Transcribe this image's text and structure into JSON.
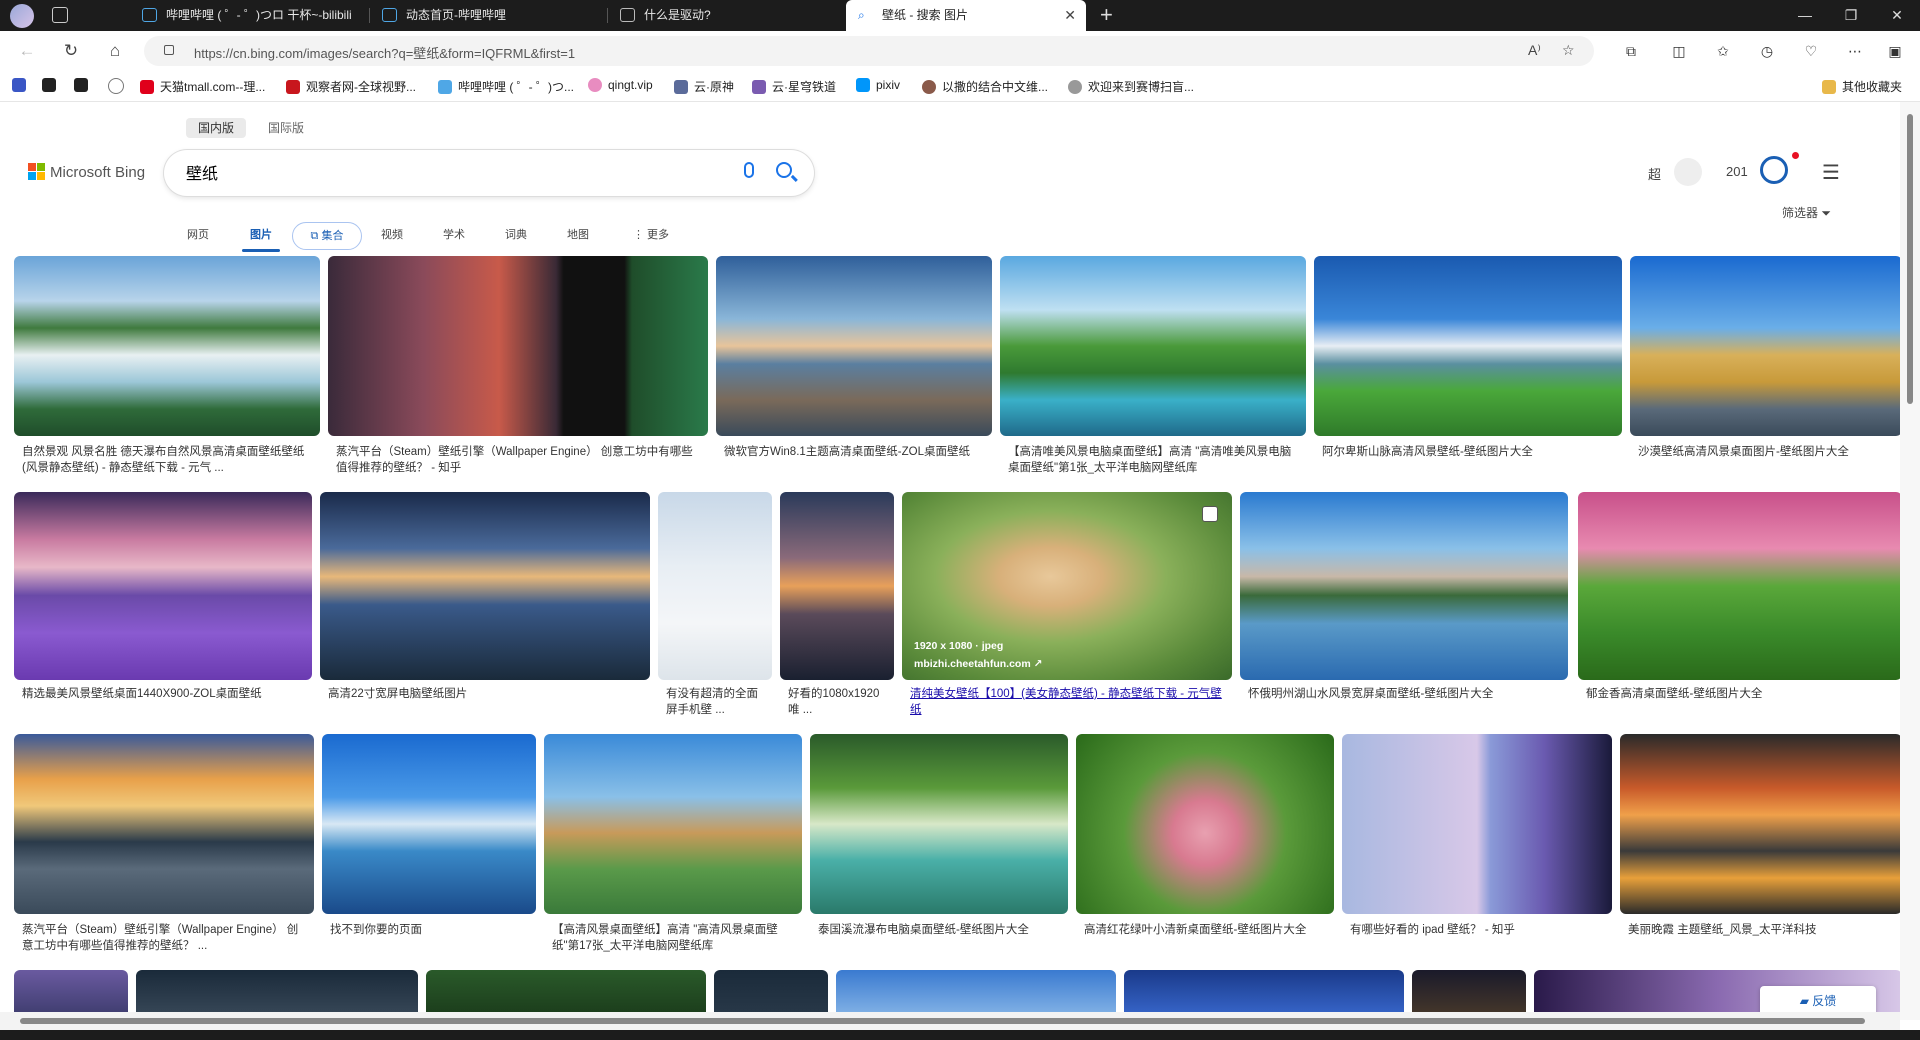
{
  "tabs": [
    {
      "label": "哔哩哔哩 ( ゜- ゜)つロ 干杯~-bilibili"
    },
    {
      "label": "动态首页-哔哩哔哩"
    },
    {
      "label": "什么是驱动?"
    },
    {
      "label": "壁纸 - 搜索 图片"
    }
  ],
  "window": {
    "new_tab": "+",
    "minimize": "—",
    "restore": "❐",
    "close": "✕",
    "tab_close": "✕"
  },
  "address": {
    "url": "https://cn.bing.com/images/search?q=壁纸&form=IQFRML&first=1",
    "read_aloud": "A⁾",
    "favorite": "☆"
  },
  "favorites": [
    {
      "label": "",
      "color": "#3a56c5"
    },
    {
      "label": "",
      "color": "#222222"
    },
    {
      "label": "",
      "color": "#222222"
    },
    {
      "label": "",
      "color": "#888888"
    },
    {
      "label": "天猫tmall.com--理...",
      "color": "#e0001b"
    },
    {
      "label": "观察者网-全球视野...",
      "color": "#c8161d"
    },
    {
      "label": "哔哩哔哩 ( ゜- ゜)つ...",
      "color": "#4fa7e6"
    },
    {
      "label": "qingt.vip",
      "color": "#e88cc0"
    },
    {
      "label": "云·原神",
      "color": "#5b6b9a"
    },
    {
      "label": "云·星穹铁道",
      "color": "#7a5bb0"
    },
    {
      "label": "pixiv",
      "color": "#0096fa"
    },
    {
      "label": "以撒的结合中文维...",
      "color": "#8a5a4a"
    },
    {
      "label": "欢迎来到赛博扫盲...",
      "color": "#999999"
    },
    {
      "label": "其他收藏夹",
      "color": "#e8b84a"
    }
  ],
  "bing": {
    "regions": [
      "国内版",
      "国际版"
    ],
    "logo": "Microsoft Bing",
    "query": "壁纸",
    "user_label": "超",
    "points": "201",
    "verticals": [
      "网页",
      "图片",
      "集合",
      "视频",
      "学术",
      "词典",
      "地图",
      "⋮ 更多"
    ],
    "filter": "筛选器",
    "feedback": "反馈"
  },
  "results": [
    {
      "caption": "自然景观 风景名胜 德天瀑布自然风景高清桌面壁纸壁纸(风景静态壁纸) - 静态壁纸下载 - 元气 ..."
    },
    {
      "caption": "蒸汽平台（Steam）壁纸引擎（Wallpaper Engine） 创意工坊中有哪些值得推荐的壁纸？ - 知乎"
    },
    {
      "caption": "微软官方Win8.1主题高清桌面壁纸-ZOL桌面壁纸"
    },
    {
      "caption": "【高清唯美风景电脑桌面壁纸】高清 \"高清唯美风景电脑桌面壁纸\"第1张_太平洋电脑网壁纸库"
    },
    {
      "caption": "阿尔卑斯山脉高清风景壁纸-壁纸图片大全"
    },
    {
      "caption": "沙漠壁纸高清风景桌面图片-壁纸图片大全"
    },
    {
      "caption": "精选最美风景壁纸桌面1440X900-ZOL桌面壁纸"
    },
    {
      "caption": "高清22寸宽屏电脑壁纸图片"
    },
    {
      "caption": "有没有超清的全面屏手机壁 ..."
    },
    {
      "caption": "好看的1080x1920唯 ..."
    },
    {
      "caption": "清纯美女壁纸【100】(美女静态壁纸) - 静态壁纸下载 - 元气壁纸",
      "meta": "1920 x 1080 · jpeg",
      "source": "mbizhi.cheetahfun.com ↗"
    },
    {
      "caption": "怀俄明州湖山水风景宽屏桌面壁纸-壁纸图片大全"
    },
    {
      "caption": "郁金香高清桌面壁纸-壁纸图片大全"
    },
    {
      "caption": "蒸汽平台（Steam）壁纸引擎（Wallpaper Engine） 创意工坊中有哪些值得推荐的壁纸？ ..."
    },
    {
      "caption": "找不到你要的页面"
    },
    {
      "caption": "【高清风景桌面壁纸】高清 \"高清风景桌面壁纸\"第17张_太平洋电脑网壁纸库"
    },
    {
      "caption": "泰国溪流瀑布电脑桌面壁纸-壁纸图片大全"
    },
    {
      "caption": "高清红花绿叶小清新桌面壁纸-壁纸图片大全"
    },
    {
      "caption": "有哪些好看的 ipad 壁纸？ - 知乎"
    },
    {
      "caption": "美丽晚霞 主题壁纸_风景_太平洋科技"
    }
  ]
}
